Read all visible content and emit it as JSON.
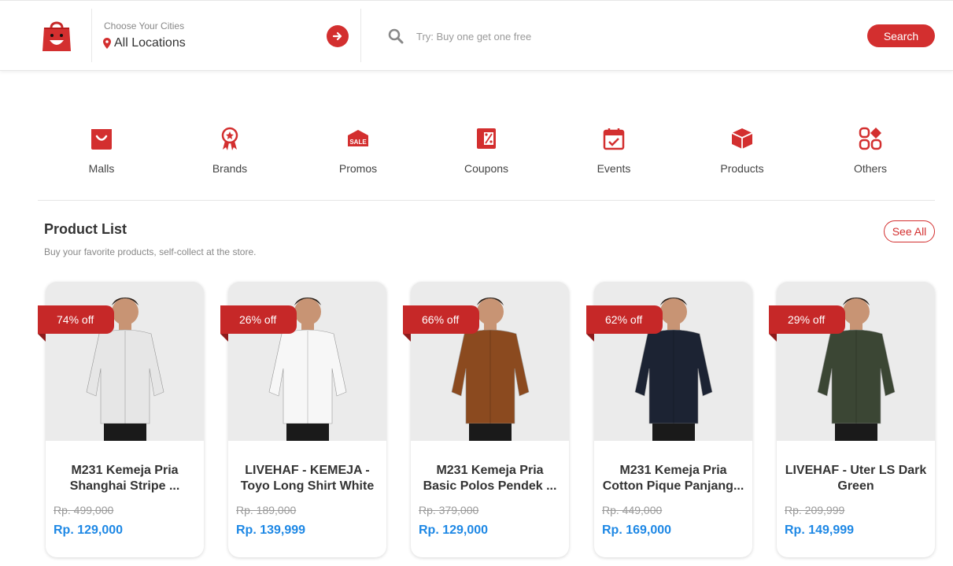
{
  "header": {
    "city_label": "Choose Your Cities",
    "city_value": "All Locations",
    "search_placeholder": "Try: Buy one get one free",
    "search_button": "Search"
  },
  "colors": {
    "brand": "#d32f2f",
    "price": "#1e88e5",
    "badge": "#c62828"
  },
  "categories": [
    {
      "label": "Malls",
      "icon": "bag-icon"
    },
    {
      "label": "Brands",
      "icon": "award-ribbon-icon"
    },
    {
      "label": "Promos",
      "icon": "sale-store-icon"
    },
    {
      "label": "Coupons",
      "icon": "coupon-icon"
    },
    {
      "label": "Events",
      "icon": "calendar-check-icon"
    },
    {
      "label": "Products",
      "icon": "box-icon"
    },
    {
      "label": "Others",
      "icon": "grid-shapes-icon"
    }
  ],
  "product_list": {
    "title": "Product List",
    "subtitle": "Buy your favorite products, self-collect at the store.",
    "see_all": "See All",
    "products": [
      {
        "discount": "74% off",
        "name_line1": "M231 Kemeja Pria",
        "name_line2": "Shanghai Stripe ...",
        "old_price": "Rp. 499,000",
        "new_price": "Rp. 129,000",
        "shirt_color": "#e6e6e6"
      },
      {
        "discount": "26% off",
        "name_line1": "LIVEHAF - KEMEJA -",
        "name_line2": "Toyo Long Shirt White",
        "old_price": "Rp. 189,000",
        "new_price": "Rp. 139,999",
        "shirt_color": "#f7f7f7"
      },
      {
        "discount": "66% off",
        "name_line1": "M231 Kemeja Pria",
        "name_line2": "Basic Polos Pendek ...",
        "old_price": "Rp. 379,000",
        "new_price": "Rp. 129,000",
        "shirt_color": "#8b4a1f"
      },
      {
        "discount": "62% off",
        "name_line1": "M231 Kemeja Pria",
        "name_line2": "Cotton Pique Panjang...",
        "old_price": "Rp. 449,000",
        "new_price": "Rp. 169,000",
        "shirt_color": "#1c2333"
      },
      {
        "discount": "29% off",
        "name_line1": "LIVEHAF - Uter LS Dark",
        "name_line2": "Green",
        "old_price": "Rp. 209,999",
        "new_price": "Rp. 149,999",
        "shirt_color": "#3b4634"
      }
    ]
  }
}
